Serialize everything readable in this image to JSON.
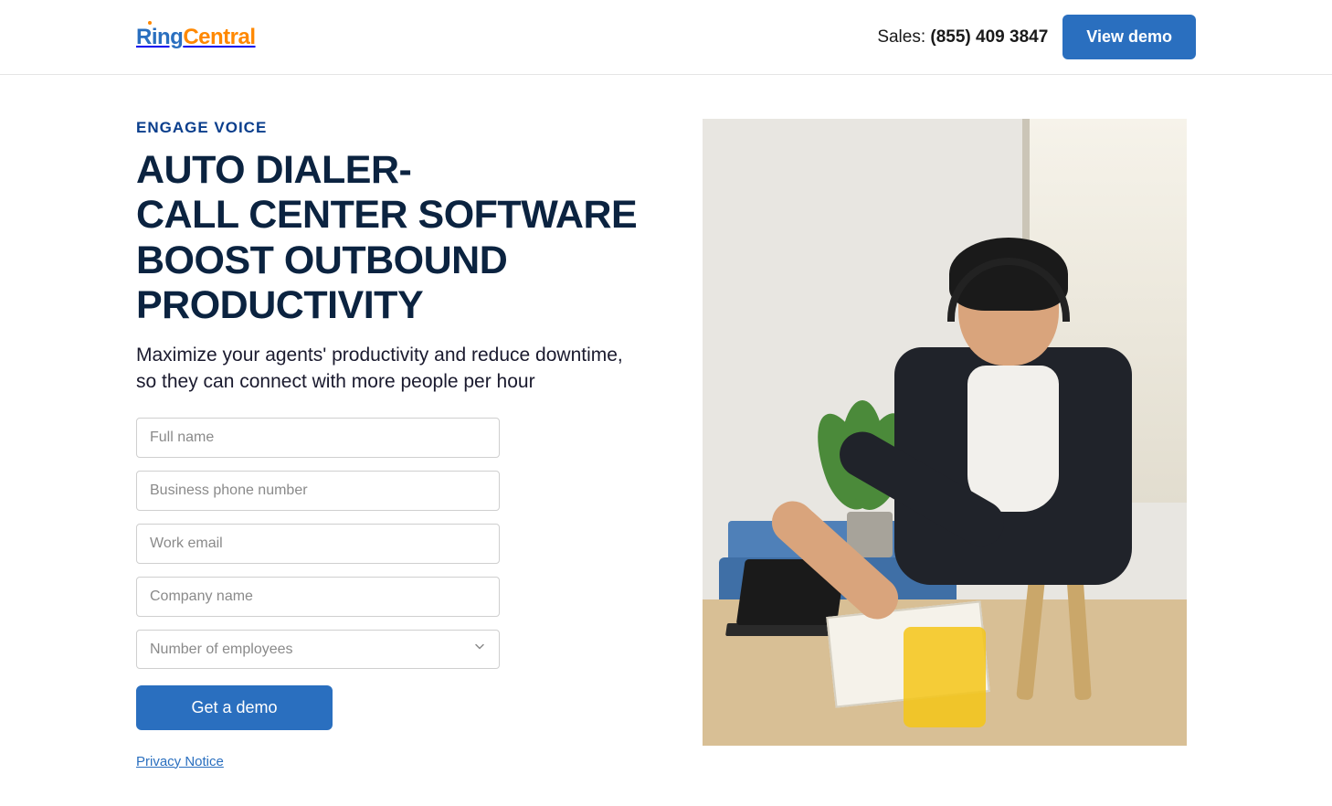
{
  "header": {
    "logo_ring": "Ring",
    "logo_central": "Central",
    "sales_label": "Sales: ",
    "sales_phone": "(855) 409 3847",
    "view_demo": "View demo"
  },
  "hero": {
    "eyebrow": "ENGAGE VOICE",
    "title_line1": "AUTO DIALER-",
    "title_line2": "CALL CENTER SOFTWARE",
    "title_line3": "BOOST OUTBOUND PRODUCTIVITY",
    "subtitle": "Maximize your agents' productivity and reduce downtime, so they can connect with more people per hour"
  },
  "form": {
    "full_name_placeholder": "Full name",
    "phone_placeholder": "Business phone number",
    "email_placeholder": "Work email",
    "company_placeholder": "Company name",
    "employees_placeholder": "Number of employees",
    "submit": "Get a demo",
    "privacy": "Privacy Notice"
  },
  "colors": {
    "primary": "#2a6fbf",
    "accent": "#ff8800",
    "heading": "#0b2340"
  }
}
